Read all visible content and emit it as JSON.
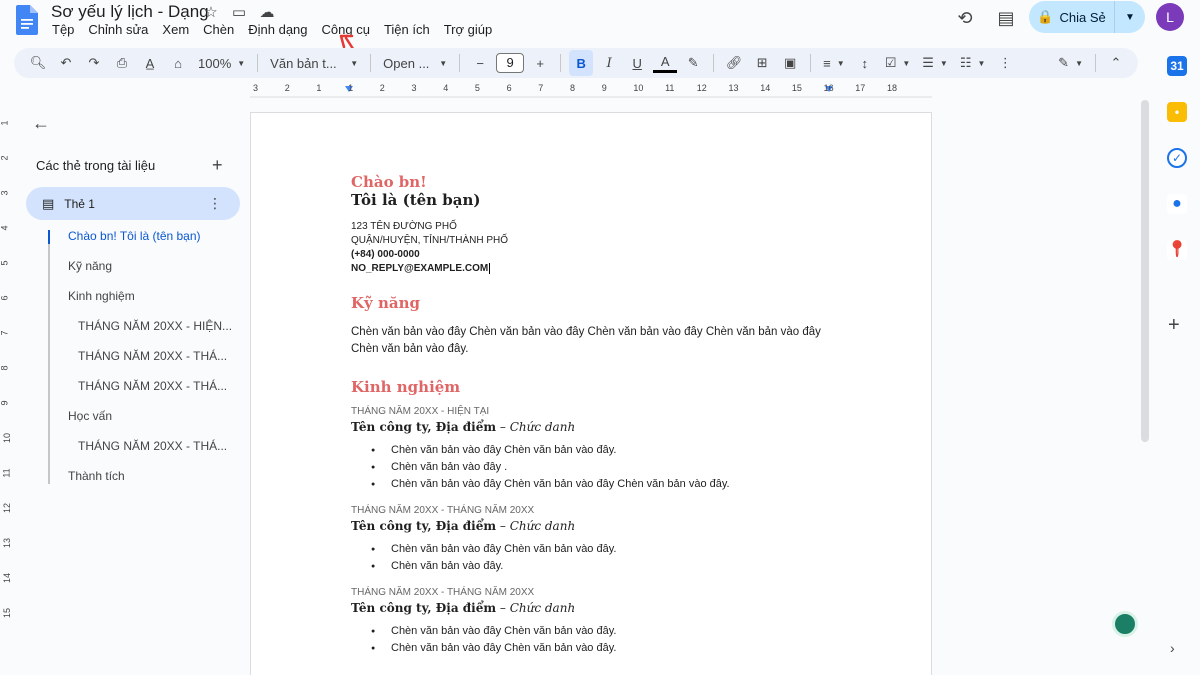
{
  "title": "Sơ yếu lý lịch - Dạng",
  "title_icons": [
    "star-icon",
    "folder-move-icon",
    "cloud-status-icon"
  ],
  "menu": [
    "Tệp",
    "Chỉnh sửa",
    "Xem",
    "Chèn",
    "Định dạng",
    "Công cụ",
    "Tiện ích",
    "Trợ giúp"
  ],
  "share_label": "Chia Sẻ",
  "avatar_initial": "L",
  "toolbar": {
    "zoom": "100%",
    "style": "Văn bản t...",
    "font": "Open ...",
    "font_size": "9",
    "bold": "B",
    "italic": "I",
    "underline": "U",
    "text_color": "A"
  },
  "ruler": {
    "h_labels": [
      "3",
      "2",
      "1",
      "1",
      "2",
      "3",
      "4",
      "5",
      "6",
      "7",
      "8",
      "9",
      "10",
      "11",
      "12",
      "13",
      "14",
      "15",
      "16",
      "17",
      "18"
    ],
    "v_labels": [
      "1",
      "2",
      "3",
      "4",
      "5",
      "6",
      "7",
      "8",
      "9",
      "10",
      "11",
      "12",
      "13",
      "14",
      "15"
    ]
  },
  "sidebar": {
    "section_title": "Các thẻ trong tài liệu",
    "tab_label": "Thẻ 1",
    "outline": [
      {
        "text": "Chào bn! Tôi là (tên bạn)",
        "level": 1,
        "active": true
      },
      {
        "text": "Kỹ năng",
        "level": 1,
        "active": false
      },
      {
        "text": "Kinh nghiệm",
        "level": 1,
        "active": false
      },
      {
        "text": "THÁNG NĂM 20XX - HIỆN...",
        "level": 2,
        "active": false
      },
      {
        "text": "THÁNG NĂM 20XX - THÁ...",
        "level": 2,
        "active": false
      },
      {
        "text": "THÁNG NĂM 20XX - THÁ...",
        "level": 2,
        "active": false
      },
      {
        "text": "Học vấn",
        "level": 1,
        "active": false
      },
      {
        "text": "THÁNG NĂM 20XX - THÁ...",
        "level": 2,
        "active": false
      },
      {
        "text": "Thành tích",
        "level": 1,
        "active": false
      }
    ]
  },
  "doc": {
    "greeting": "Chào bn!",
    "name": "Tôi là (tên bạn)",
    "address1": "123 TÊN ĐƯỜNG PHỐ",
    "address2": "QUẬN/HUYỆN, TỈNH/THÀNH PHỐ",
    "phone": "(+84) 000-0000",
    "email": "NO_REPLY@EXAMPLE.COM",
    "skills_heading": "Kỹ năng",
    "skills_text": "Chèn văn bản vào đây Chèn văn bản vào đây Chèn văn bản vào đây Chèn văn bản vào đây Chèn văn bản vào đây.",
    "exp_heading": "Kinh nghiệm",
    "jobs": [
      {
        "date": "THÁNG NĂM 20XX - HIỆN TẠI",
        "company": "Tên công ty, Địa điểm",
        "role": "Chức danh",
        "bullets": [
          "Chèn văn bản vào đây Chèn văn bản vào đây.",
          "Chèn văn bản vào đây .",
          "Chèn văn bản vào đây Chèn văn bản vào đây Chèn văn bản vào đây."
        ]
      },
      {
        "date": "THÁNG NĂM 20XX - THÁNG NĂM 20XX",
        "company": "Tên công ty, Địa điểm",
        "role": "Chức danh",
        "bullets": [
          "Chèn văn bản vào đây Chèn văn bản vào đây.",
          "Chèn văn bản vào đây."
        ]
      },
      {
        "date": "THÁNG NĂM 20XX - THÁNG NĂM 20XX",
        "company": "Tên công ty, Địa điểm",
        "role": "Chức danh",
        "bullets": [
          "Chèn văn bản vào đây Chèn văn bản vào đây.",
          "Chèn văn bản vào đây Chèn văn bản vào đây."
        ]
      }
    ]
  },
  "colors": {
    "heading_red": "#e06666",
    "accent_blue": "#0b57d0",
    "toolbar_bg": "#edf2fa",
    "share_bg": "#c2e7ff",
    "avatar_bg": "#7b3ab9",
    "annotation_arrow": "#e53935"
  }
}
